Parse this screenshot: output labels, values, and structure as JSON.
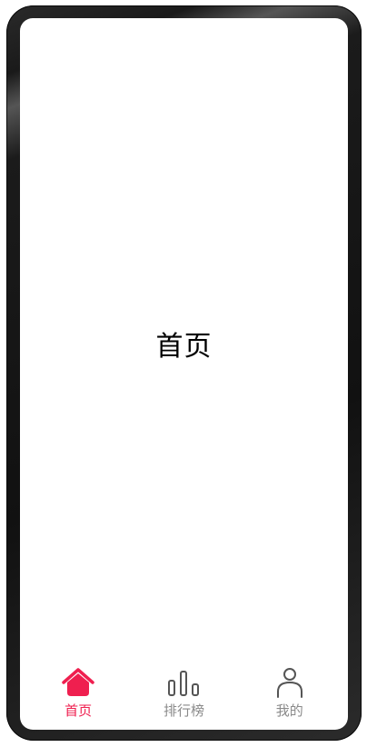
{
  "main": {
    "title": "首页"
  },
  "tabbar": {
    "active_color": "#ef1f4f",
    "inactive_color": "#8a8a8a",
    "items": [
      {
        "label": "首页",
        "icon": "home-icon",
        "active": true
      },
      {
        "label": "排行榜",
        "icon": "bar-chart-icon",
        "active": false
      },
      {
        "label": "我的",
        "icon": "person-icon",
        "active": false
      }
    ]
  }
}
